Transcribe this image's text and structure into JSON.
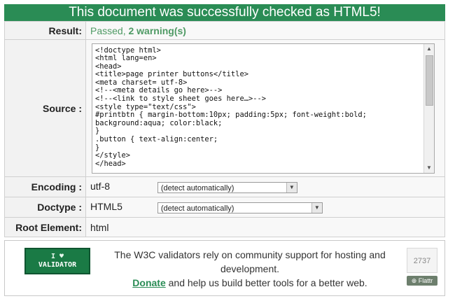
{
  "banner": {
    "title": "This document was successfully checked as HTML5!"
  },
  "result": {
    "label": "Result:",
    "status": "Passed,",
    "warnings": "2 warning(s)"
  },
  "source": {
    "label": "Source :",
    "code": "<!doctype html>\n<html lang=en>\n<head>\n<title>page printer buttons</title>\n<meta charset= utf-8>\n<!--<meta details go here>-->\n<!--<link to style sheet goes here…>-->\n<style type=\"text/css\">\n#printbtn { margin-bottom:10px; padding:5px; font-weight:bold;\nbackground:aqua; color:black;\n}\n.button { text-align:center;\n}\n</style>\n</head>"
  },
  "encoding": {
    "label": "Encoding :",
    "value": "utf-8",
    "select": "(detect automatically)"
  },
  "doctype": {
    "label": "Doctype :",
    "value": "HTML5",
    "select": "(detect automatically)"
  },
  "root": {
    "label": "Root Element:",
    "value": "html"
  },
  "footer": {
    "badge_line1": "I ♥",
    "badge_line2": "VALIDATOR",
    "text_line1": "The W3C validators rely on community support for hosting and",
    "text_line2": "development.",
    "donate": "Donate",
    "text_line3": " and help us build better tools for a better web.",
    "flattr_count": "2737",
    "flattr_label": "Flattr"
  },
  "colors": {
    "accent": "#2a8c55",
    "passed": "#4e9a64"
  }
}
